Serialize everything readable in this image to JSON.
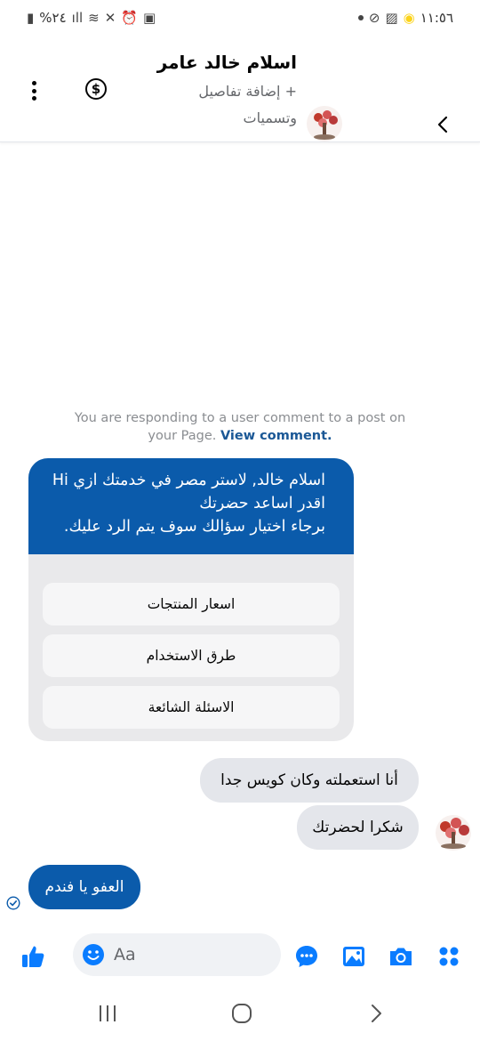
{
  "status_bar": {
    "time": "١١:٥٦",
    "battery_text": "%٢٤"
  },
  "header": {
    "contact_name": "اسلام خالد عامر",
    "add_details": "+ إضافة تفاصيل وتسميات"
  },
  "chat": {
    "notice_text": "You are responding to a user comment to a post on your Page.",
    "notice_link": "View comment.",
    "bot_message": [
      "اسلام خالد, لاستر مصر في خدمتك ازي Hi",
      "اقدر اساعد حضرتك",
      "برجاء اختيار سؤالك سوف يتم الرد عليك."
    ],
    "quick_replies": [
      "اسعار المنتجات",
      "طرق الاستخدام",
      "الاسئلة الشائعة"
    ],
    "incoming": [
      "أنا استعملته وكان كويس جدا",
      "شكرا لحضرتك"
    ],
    "outgoing": "العفو يا فندم"
  },
  "composer": {
    "placeholder": "Aa"
  },
  "colors": {
    "accent": "#0b5bab",
    "messenger_blue": "#0a7cff",
    "bubble_gray": "#e4e6eb"
  },
  "icons": {
    "composer": [
      "apps-icon",
      "camera-icon",
      "gallery-icon",
      "chat-bubble-icon",
      "emoji-icon",
      "thumbs-up-icon"
    ],
    "header": [
      "back-icon",
      "dollar-icon",
      "more-icon"
    ]
  }
}
